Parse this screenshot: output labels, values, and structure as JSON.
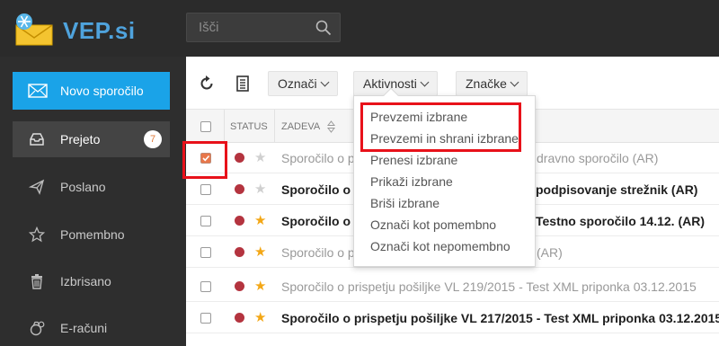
{
  "header": {
    "logo_text": "VEP.si",
    "search_placeholder": "Išči"
  },
  "sidebar": {
    "new_message_label": "Novo sporočilo",
    "items": [
      {
        "label": "Prejeto",
        "icon": "inbox-icon",
        "badge": "7"
      },
      {
        "label": "Poslano",
        "icon": "send-icon"
      },
      {
        "label": "Pomembno",
        "icon": "star-icon"
      },
      {
        "label": "Izbrisano",
        "icon": "trash-icon"
      },
      {
        "label": "E-računi",
        "icon": "money-bag-icon"
      }
    ]
  },
  "toolbar": {
    "buttons": [
      {
        "label": "Označi"
      },
      {
        "label": "Aktivnosti"
      },
      {
        "label": "Značke"
      }
    ]
  },
  "table": {
    "columns": {
      "status": "STATUS",
      "subject": "ZADEVA"
    },
    "rows": [
      {
        "checked": true,
        "starred": false,
        "unread": false,
        "subject_start": "Sporočilo o p",
        "subject_end": "dravno sporočilo (AR)"
      },
      {
        "checked": false,
        "starred": false,
        "unread": true,
        "subject_start": "Sporočilo o p",
        "subject_end": "podpisovanje strežnik (AR)"
      },
      {
        "checked": false,
        "starred": true,
        "unread": true,
        "subject_start": "Sporočilo o p",
        "subject_end": "Testno sporočilo 14.12. (AR)"
      },
      {
        "checked": false,
        "starred": true,
        "unread": false,
        "subject_start": "Sporočilo o p",
        "subject_end": "(AR)"
      },
      {
        "checked": false,
        "starred": true,
        "unread": false,
        "subject_start": "Sporočilo o prispetju pošiljke VL 219/2015 - Test XML priponka 03.12.2015",
        "subject_end": ""
      },
      {
        "checked": false,
        "starred": true,
        "unread": true,
        "subject_start": "Sporočilo o prispetju pošiljke VL 217/2015 - Test XML priponka 03.12.2015",
        "subject_end": ""
      }
    ]
  },
  "dropdown": {
    "items": [
      "Prevzemi izbrane",
      "Prevzemi in shrani izbrane",
      "Prenesi izbrane",
      "Prikaži izbrane",
      "Briši izbrane",
      "Označi kot pomembno",
      "Označi kot nepomembno"
    ]
  },
  "colors": {
    "accent": "#1aa3e8",
    "status_dot": "#b4343f",
    "star_on": "#f3a716",
    "annotation": "#e8111a"
  }
}
